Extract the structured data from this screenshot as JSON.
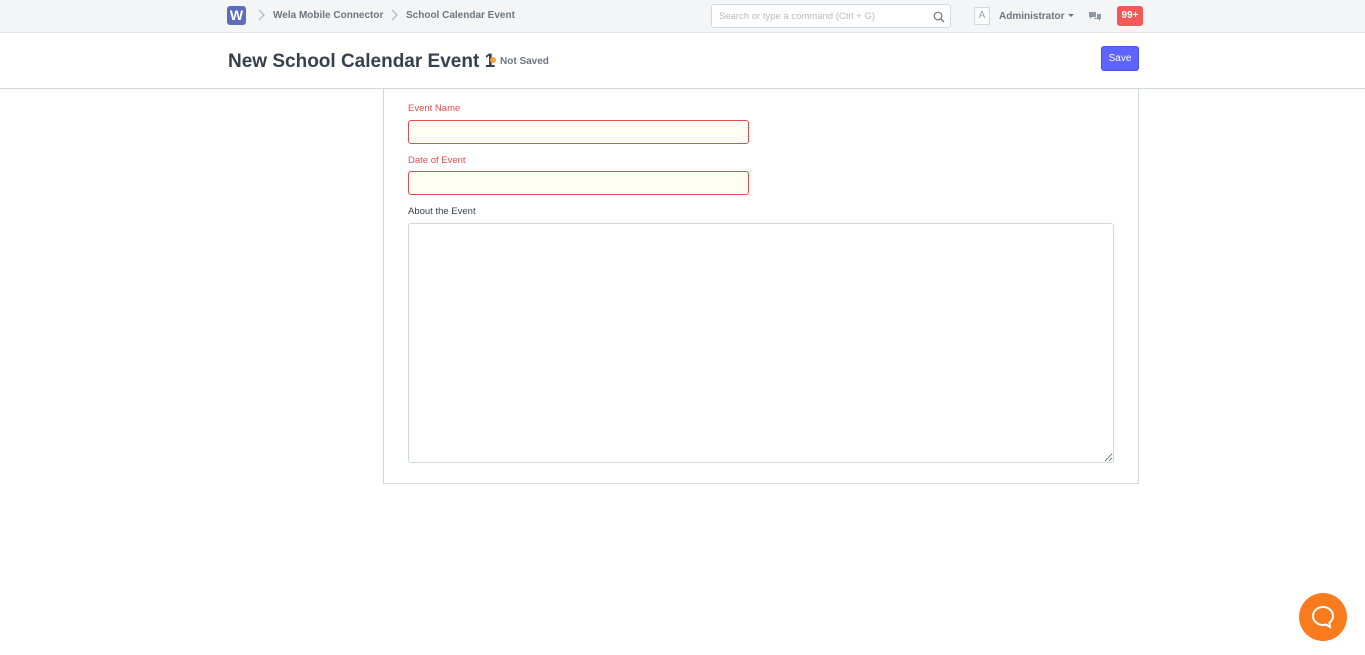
{
  "navbar": {
    "logo_letter": "W",
    "breadcrumbs": [
      {
        "label": "Wela Mobile Connector"
      },
      {
        "label": "School Calendar Event"
      }
    ],
    "search_placeholder": "Search or type a command (Ctrl + G)",
    "avatar_letter": "A",
    "user_label": "Administrator",
    "notifications_count": "99+",
    "icons": {
      "logo": "app-logo",
      "separator": "chevron-right-icon",
      "search": "search-icon",
      "chat": "chat-icon"
    }
  },
  "page": {
    "title": "New School Calendar Event 1",
    "status": "Not Saved",
    "save_label": "Save"
  },
  "form": {
    "fields": [
      {
        "label": "Event Name",
        "value": "",
        "required": true
      },
      {
        "label": "Date of Event",
        "value": "",
        "required": true
      },
      {
        "label": "About the Event",
        "value": "",
        "required": false
      }
    ]
  },
  "colors": {
    "primary": "#5e64ff",
    "required": "#e24c4c",
    "status_dot": "#f8a13f",
    "badge": "#f25a5a",
    "chat_bubble": "#f97b1e",
    "logo": "#5d6dbe"
  }
}
